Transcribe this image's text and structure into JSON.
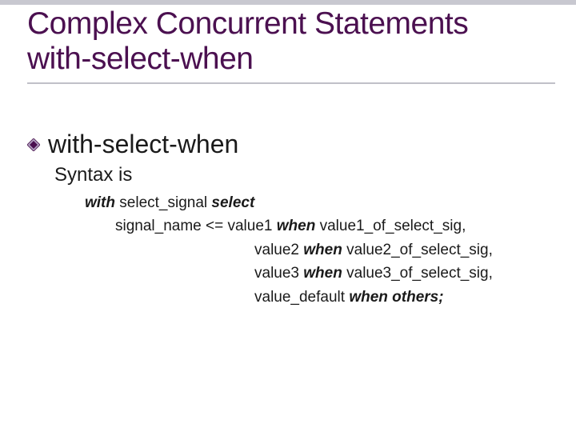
{
  "title": {
    "line1": "Complex Concurrent Statements",
    "line2": "with-select-when"
  },
  "bullet": {
    "text": "with-select-when"
  },
  "sub": {
    "text": "Syntax is"
  },
  "code": {
    "kw_with": "with",
    "sel_sig": " select_signal ",
    "kw_select": "select",
    "l2_a": "signal_name <= value1 ",
    "kw_when1": "when",
    "l2_b": " value1_of_select_sig,",
    "l3_a": "value2 ",
    "kw_when2": "when",
    "l3_b": " value2_of_select_sig,",
    "l4_a": "value3 ",
    "kw_when3": "when",
    "l4_b": " value3_of_select_sig,",
    "l5_a": "value_default ",
    "kw_when_others": "when others;"
  }
}
